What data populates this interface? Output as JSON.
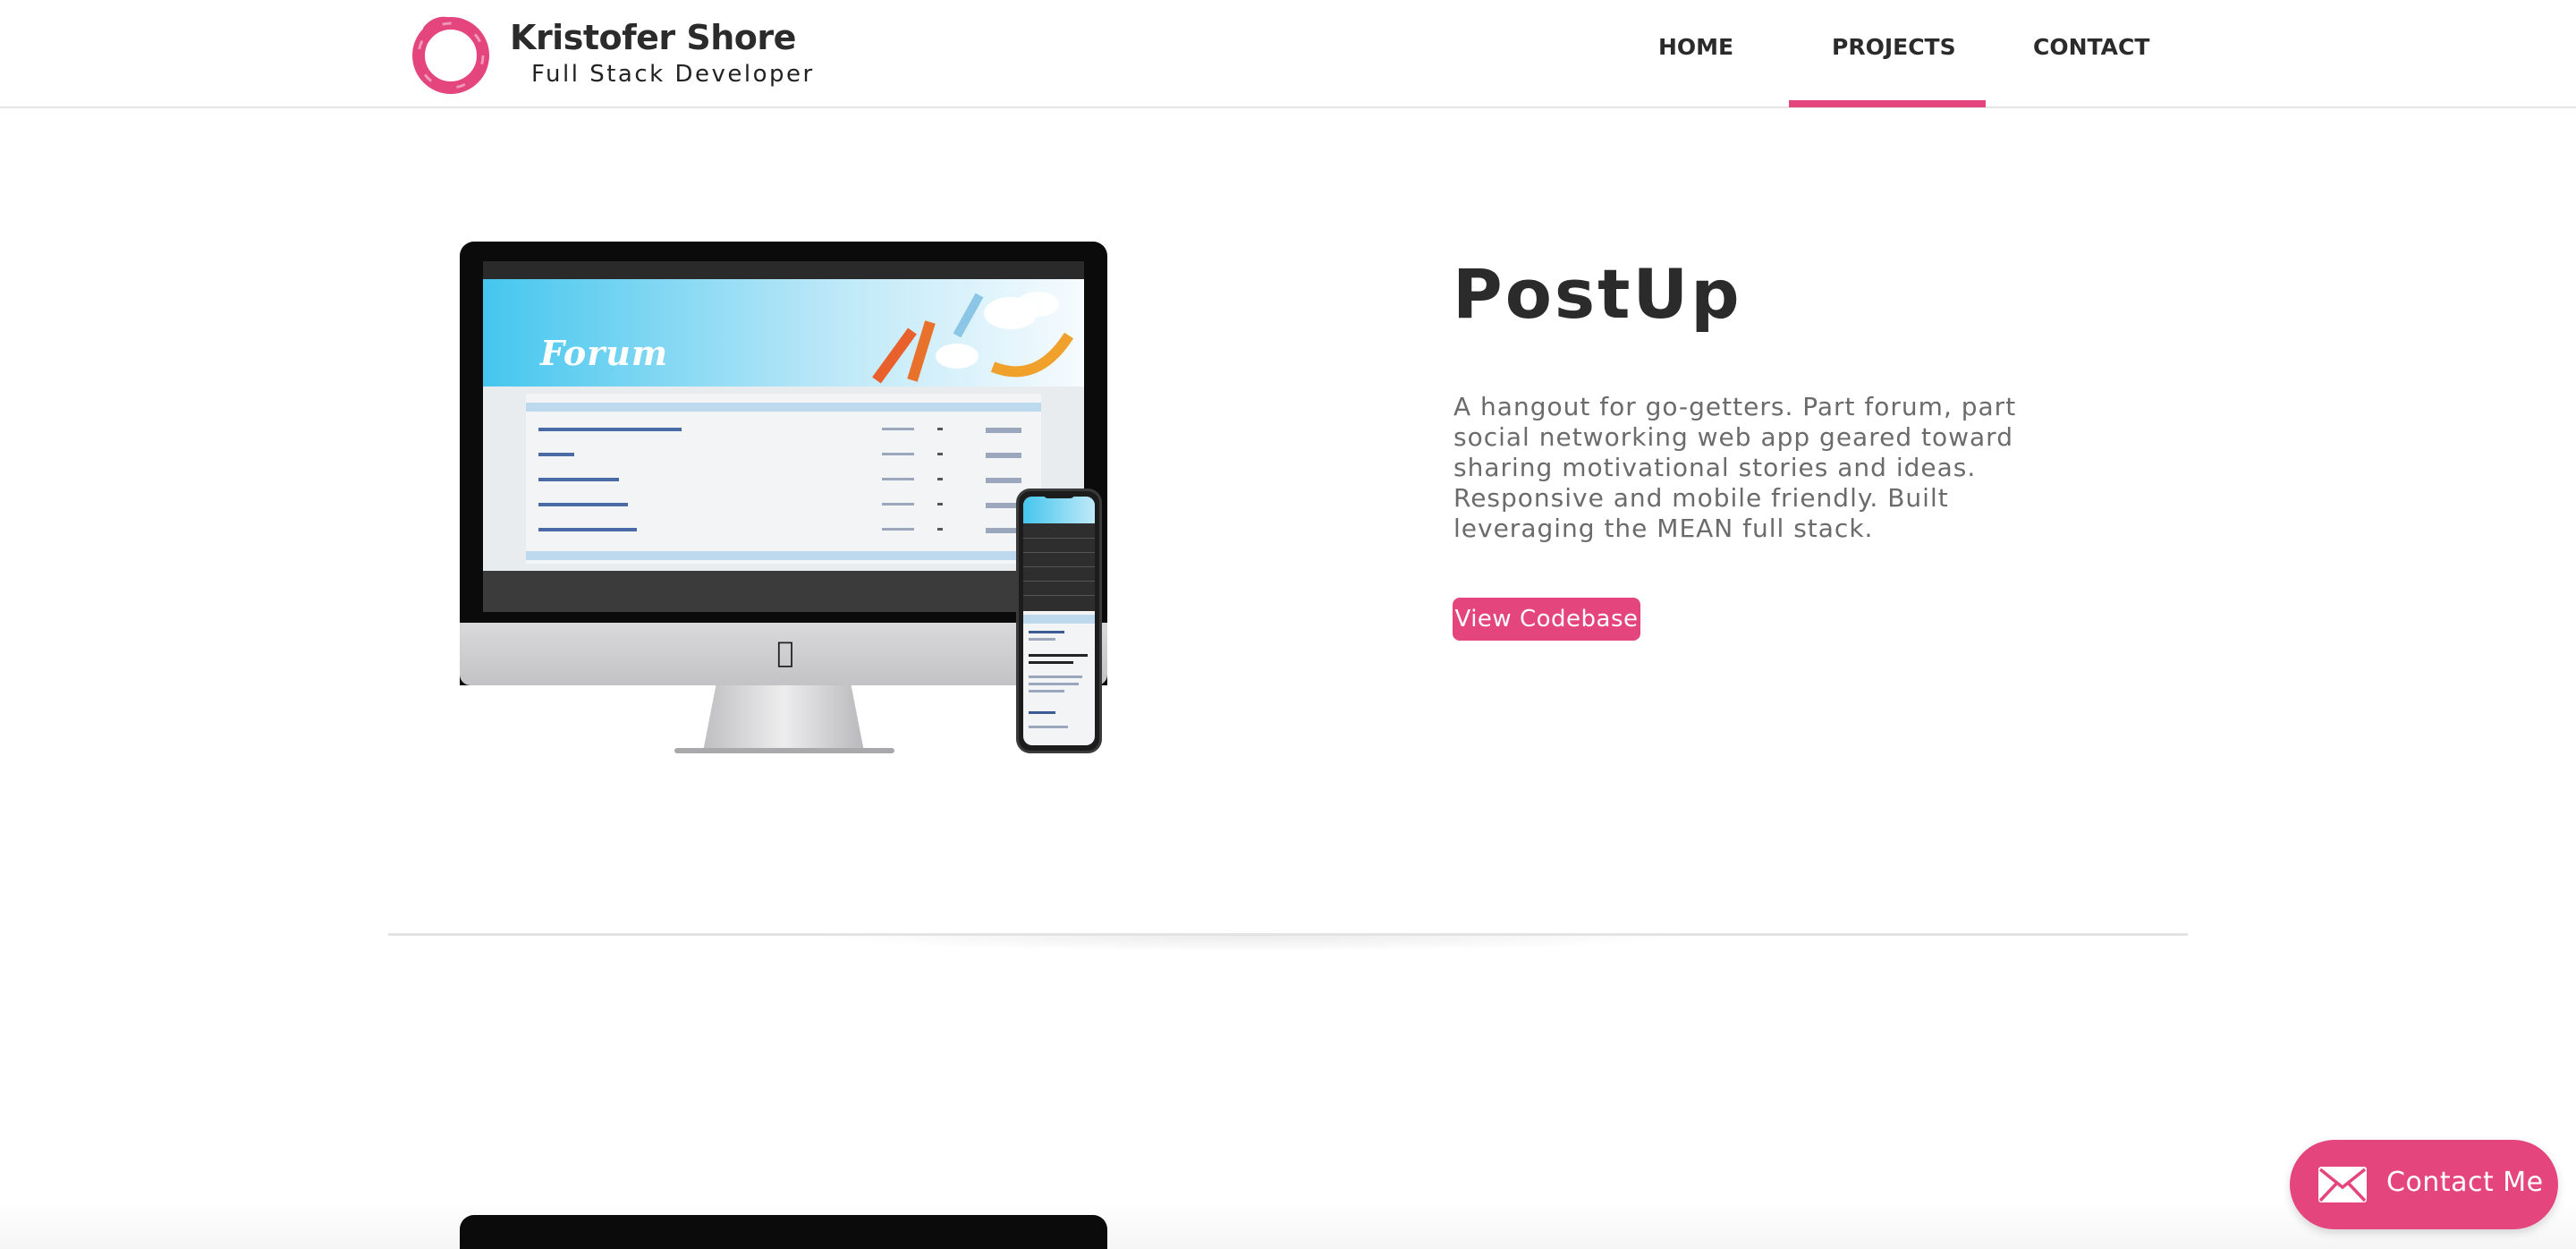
{
  "header": {
    "name": "Kristofer Shore",
    "subtitle": "Full Stack Developer",
    "nav": [
      {
        "label": "HOME"
      },
      {
        "label": "PROJECTS"
      },
      {
        "label": "CONTACT"
      }
    ],
    "active_nav": "PROJECTS"
  },
  "project": {
    "title": "PostUp",
    "description": "A hangout for go-getters. Part forum, part social networking web app geared toward sharing motivational stories and ideas. Responsive and mobile friendly. Built leveraging the MEAN full stack.",
    "button_label": "View Codebase",
    "screenshot_banner": "Forum"
  },
  "contact_fab": {
    "label": "Contact Me",
    "icon": "envelope-icon"
  },
  "colors": {
    "accent": "#e4457c",
    "text_dark": "#2b2b2b",
    "text_muted": "#6b6b6b"
  }
}
